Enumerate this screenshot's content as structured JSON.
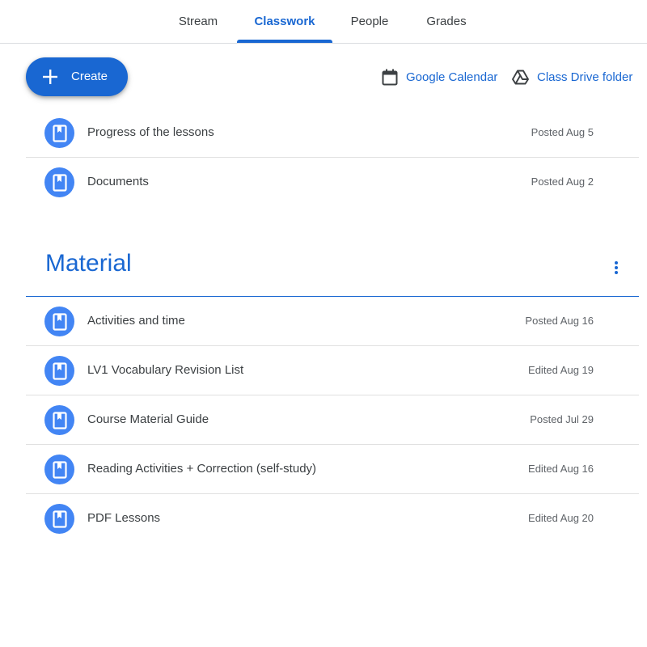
{
  "tabs": [
    {
      "label": "Stream",
      "active": false
    },
    {
      "label": "Classwork",
      "active": true
    },
    {
      "label": "People",
      "active": false
    },
    {
      "label": "Grades",
      "active": false
    }
  ],
  "toolbar": {
    "create_label": "Create",
    "calendar_label": "Google Calendar",
    "drive_label": "Class Drive folder"
  },
  "top_items": [
    {
      "title": "Progress of the lessons",
      "date": "Posted Aug 5",
      "icon": "material-icon"
    },
    {
      "title": "Documents",
      "date": "Posted Aug 2",
      "icon": "material-icon"
    }
  ],
  "section": {
    "title": "Material",
    "items": [
      {
        "title": "Activities and time",
        "date": "Posted Aug 16",
        "icon": "material-icon"
      },
      {
        "title": "LV1 Vocabulary Revision List",
        "date": "Edited Aug 19",
        "icon": "material-icon"
      },
      {
        "title": "Course Material Guide",
        "date": "Posted Jul 29",
        "icon": "material-icon"
      },
      {
        "title": "Reading Activities + Correction (self-study)",
        "date": "Edited Aug 16",
        "icon": "material-icon"
      },
      {
        "title": "PDF Lessons",
        "date": "Edited Aug 20",
        "icon": "material-icon"
      }
    ]
  },
  "colors": {
    "accent": "#1967d2",
    "icon_bg": "#4285f4",
    "text": "#3c4043",
    "muted": "#5f6368",
    "divider": "#e0e0e0"
  }
}
